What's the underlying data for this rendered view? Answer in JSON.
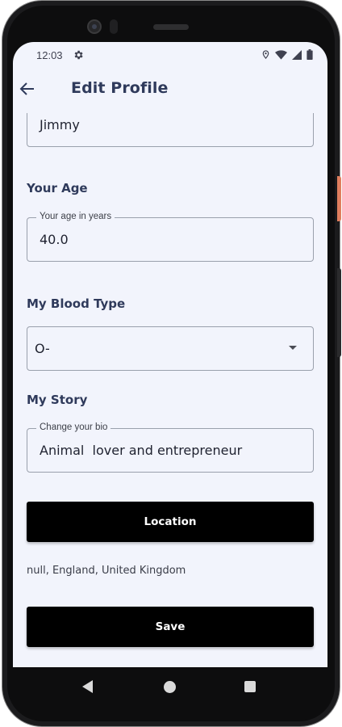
{
  "status_bar": {
    "time": "12:03",
    "icons": [
      "settings-icon",
      "location-icon",
      "wifi-icon",
      "signal-icon",
      "battery-icon"
    ]
  },
  "app_bar": {
    "title": "Edit Profile",
    "back_icon": "arrow-back-icon"
  },
  "form": {
    "name_field": {
      "value": "Jimmy"
    },
    "age_section": {
      "title": "Your Age",
      "label": "Your age in years",
      "value": "40.0"
    },
    "blood_section": {
      "title": "My Blood Type",
      "selected": "O-"
    },
    "story_section": {
      "title": "My Story",
      "label": "Change your bio",
      "value": "Animal  lover and entrepreneur"
    },
    "location_button": "Location",
    "location_text": "null, England, United Kingdom",
    "save_button": "Save"
  },
  "colors": {
    "background": "#f2f4fc",
    "title": "#2f3a5b",
    "button": "#000000",
    "button_text": "#ffffff"
  },
  "nav_bar": {
    "icons": [
      "nav-back-icon",
      "nav-home-icon",
      "nav-recents-icon"
    ]
  }
}
